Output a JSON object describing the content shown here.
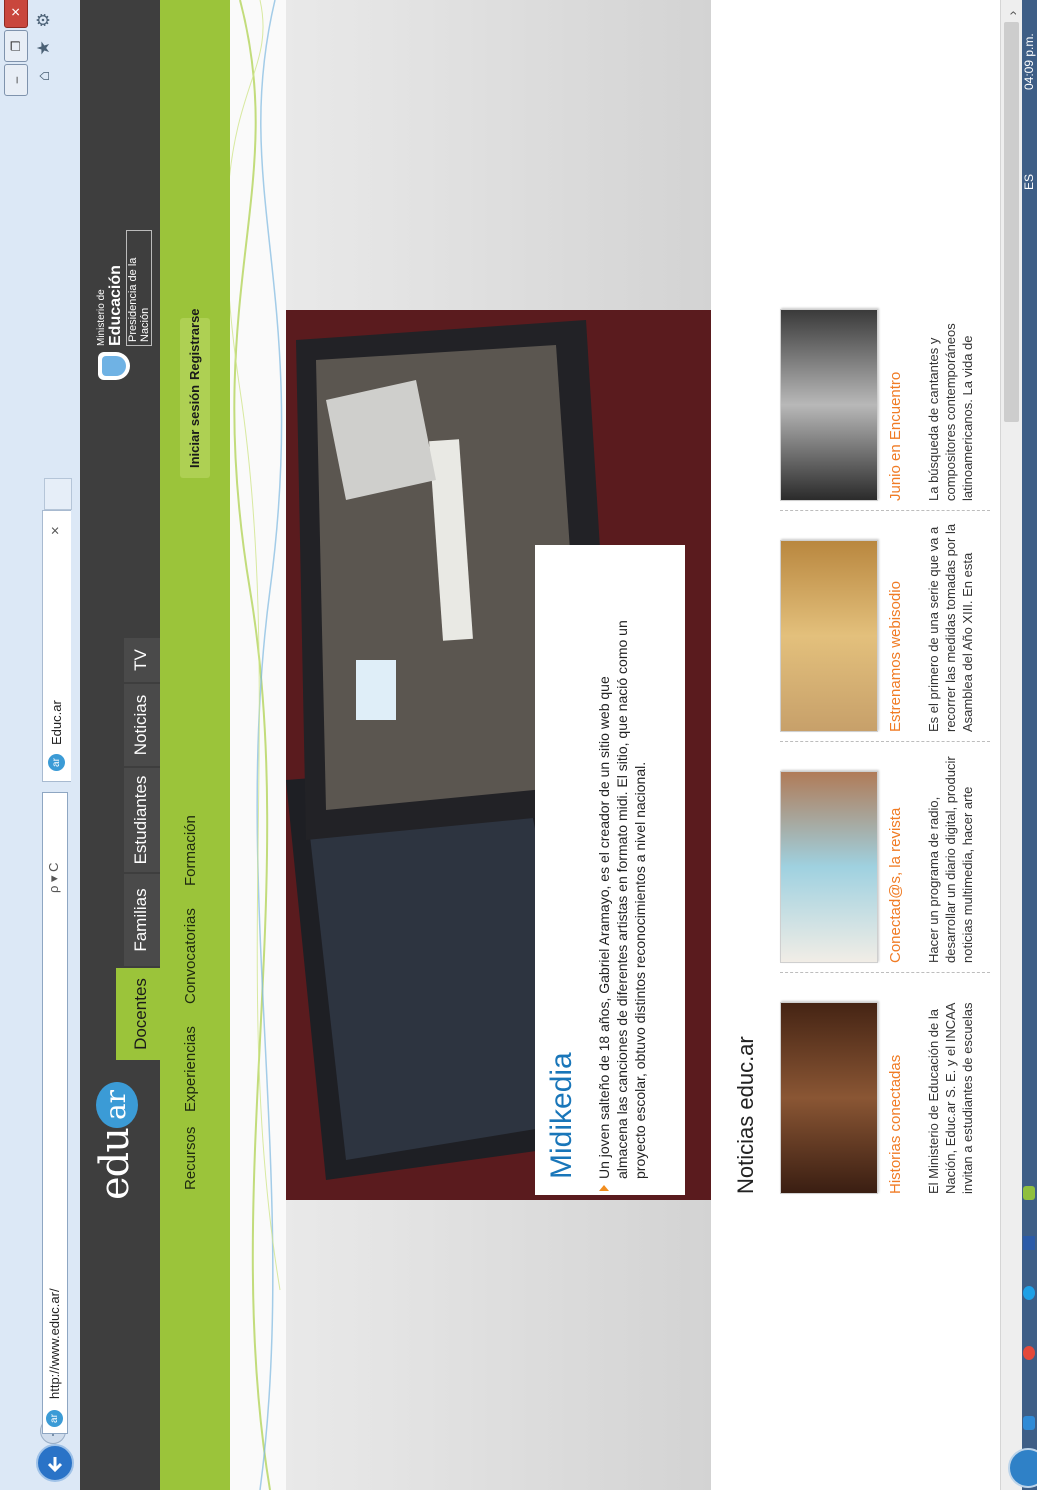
{
  "browser": {
    "url": "http://www.educ.ar/",
    "tab_title": "Educ.ar",
    "tab_close": "×",
    "address_tools": "ρ ▾ C",
    "window_buttons": {
      "minimize": "–",
      "restore": "❐",
      "close": "✕"
    },
    "icons": [
      "back-arrow-icon",
      "forward-arrow-icon",
      "home-icon",
      "star-icon",
      "gear-icon"
    ]
  },
  "site": {
    "logo": "educ",
    "logo_badge": "ar",
    "tabs": [
      {
        "label": "Docentes",
        "active": true
      },
      {
        "label": "Familias",
        "active": false
      },
      {
        "label": "Estudiantes",
        "active": false
      },
      {
        "label": "Noticias",
        "active": false
      },
      {
        "label": "TV",
        "active": false
      }
    ],
    "ministerio": {
      "line1": "Ministerio de",
      "line2": "Educación",
      "line3": "Presidencia de la Nación"
    },
    "subnav": [
      "Recursos",
      "Experiencias",
      "Convocatorias",
      "Formación"
    ],
    "login": "Iniciar sesión",
    "register": "Registrarse"
  },
  "hero": {
    "title": "Midikedia",
    "body": "Un joven salteño de 18 años, Gabriel Aramayo, es el creador de un sitio web que almacena las canciones de diferentes artistas en formato midi. El sitio, que nació como un proyecto escolar, obtuvo distintos reconocimientos a nivel nacional."
  },
  "news": {
    "heading": "Noticias educ.ar",
    "cards": [
      {
        "title": "Historias conectadas",
        "text": "El Ministerio de Educación de la Nación, Educ.ar S. E. y el INCAA invitan a estudiantes de escuelas"
      },
      {
        "title": "Conectad@s, la revista",
        "text": "Hacer un programa de radio, desarrollar un diario digital, producir noticias multimedia, hacer arte"
      },
      {
        "title": "Estrenamos webisodio",
        "text": "Es el primero de una serie que va a recorrer las medidas tomadas por la Asamblea del Año XIII. En esta"
      },
      {
        "title": "Junio en Encuentro",
        "text": "La búsqueda de cantantes y compositores contemporáneos latinoamericanos. La vida de"
      }
    ]
  },
  "taskbar": {
    "lang": "ES",
    "clock": "04:09 p.m."
  },
  "colors": {
    "nav_dark": "#3e3e3e",
    "accent_green": "#9bc43a",
    "link_orange": "#f07b24",
    "title_blue": "#1976b9"
  }
}
